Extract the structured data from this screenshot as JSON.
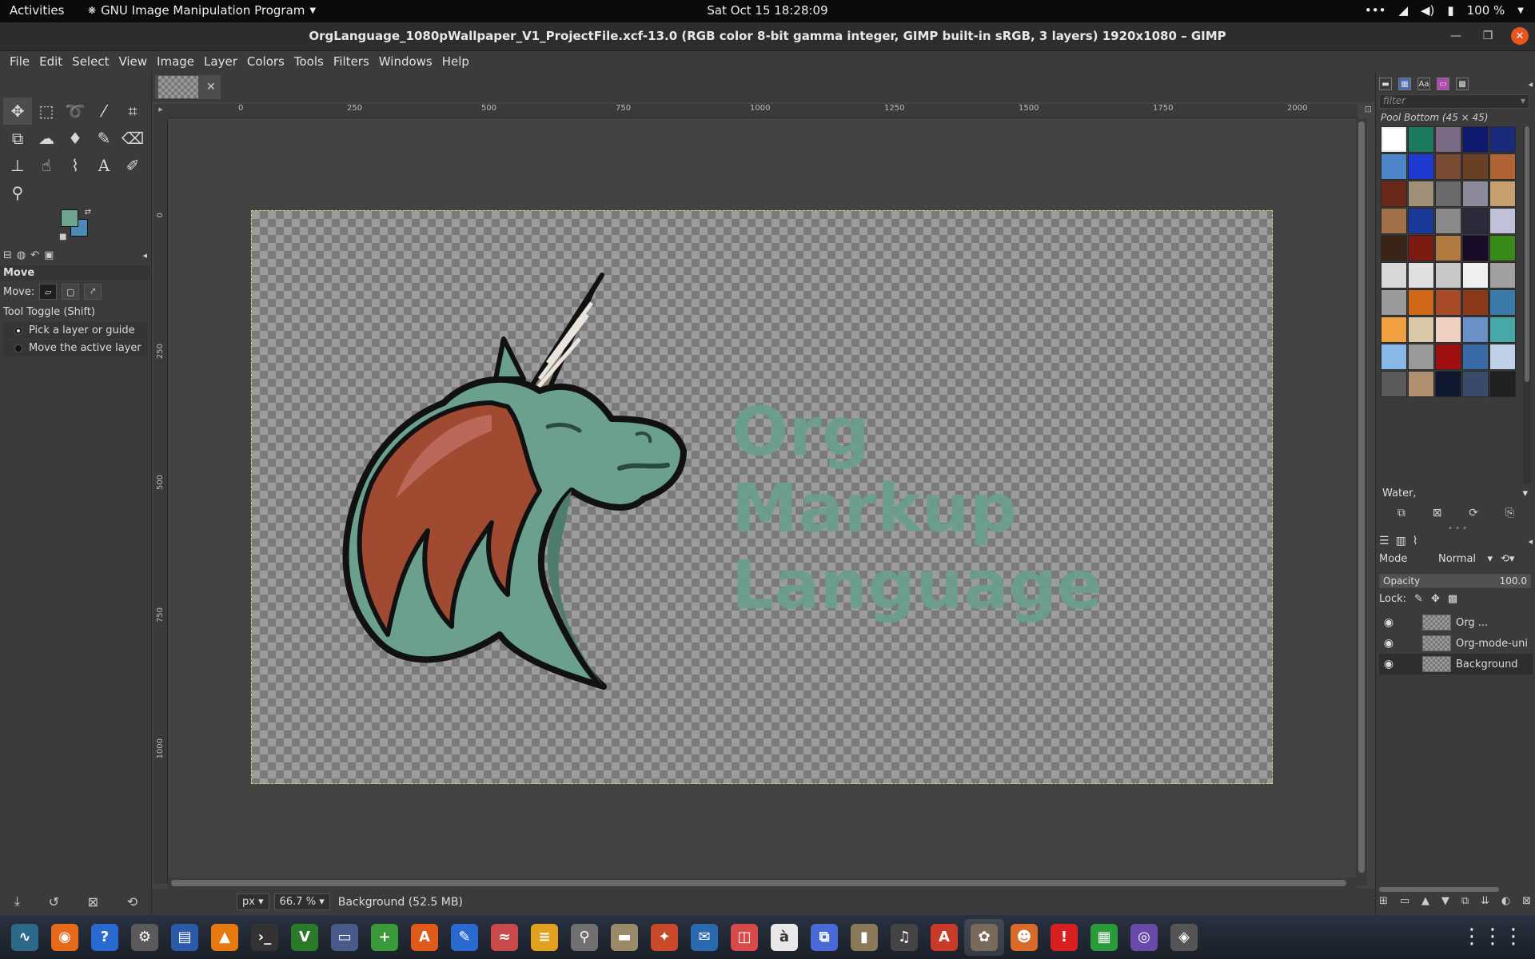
{
  "system": {
    "activities": "Activities",
    "app_menu": "GNU Image Manipulation Program",
    "clock": "Sat Oct 15  18:28:09",
    "battery": "100 %"
  },
  "window": {
    "title": "OrgLanguage_1080pWallpaper_V1_ProjectFile.xcf-13.0 (RGB color 8-bit gamma integer, GIMP built-in sRGB, 3 layers) 1920x1080 – GIMP"
  },
  "menu": [
    "File",
    "Edit",
    "Select",
    "View",
    "Image",
    "Layer",
    "Colors",
    "Tools",
    "Filters",
    "Windows",
    "Help"
  ],
  "toolbox": {
    "colors": {
      "foreground": "#6ea591",
      "background": "#4a8ab4"
    }
  },
  "tool_options": {
    "tool_name": "Move",
    "move_label": "Move:",
    "toggle_label": "Tool Toggle  (Shift)",
    "radio_1": "Pick a layer or guide",
    "radio_2": "Move the active layer"
  },
  "rulers": {
    "h_labels": [
      "0",
      "250",
      "500",
      "750",
      "1000",
      "1250",
      "1500",
      "1750",
      "2000"
    ],
    "v_labels": [
      "0",
      "250",
      "500",
      "750",
      "1000"
    ]
  },
  "canvas": {
    "line1": "Org",
    "line2": "Markup",
    "line3": "Language"
  },
  "status": {
    "unit": "px",
    "zoom": "66.7 %",
    "text": "Background (52.5 MB)"
  },
  "patterns_panel": {
    "filter_placeholder": "filter",
    "current_pattern": "Pool Bottom (45 × 45)",
    "selected_tag": "Water,",
    "swatches": [
      "#ffffff",
      "#1b7a5e",
      "#7a6a86",
      "#0d1a6e",
      "#1a2a7a",
      "#4a86c8",
      "#1e3ad0",
      "#7a4a32",
      "#6a4024",
      "#b06434",
      "#6a2a1a",
      "#a09078",
      "#6a6a6a",
      "#8a8a9a",
      "#c8a070",
      "#a07048",
      "#1a3a9a",
      "#8a8a8a",
      "#2a2a3a",
      "#c0c0d8",
      "#3a2418",
      "#7a1a10",
      "#b07a40",
      "#1a0a2a",
      "#3a8a1a",
      "#d8d8d8",
      "#e0e0e0",
      "#c8c8c8",
      "#f0f0f0",
      "#a0a0a0",
      "#9a9a9a",
      "#d06818",
      "#a84a28",
      "#8a3a1a",
      "#3a7aa8",
      "#f0a040",
      "#d8c8a8",
      "#f0d0c0",
      "#6a90c8",
      "#48a8a8",
      "#88b8e8",
      "#9a9a9a",
      "#a01010",
      "#3a6aa8",
      "#c0d0e8",
      "#5a5a5a",
      "#b09070",
      "#101830",
      "#3a4a6a",
      "#202020"
    ]
  },
  "layers_panel": {
    "mode_label": "Mode",
    "mode_value": "Normal",
    "opacity_label": "Opacity",
    "opacity_value": "100.0",
    "lock_label": "Lock:",
    "layers": [
      {
        "name": "Org ..."
      },
      {
        "name": "Org-mode-uni"
      },
      {
        "name": "Background"
      }
    ]
  },
  "taskbar": {
    "apps": [
      {
        "name": "system-monitor",
        "glyph": "∿",
        "color": "#2d6a8a"
      },
      {
        "name": "firefox",
        "glyph": "◉",
        "color": "#e66a1a"
      },
      {
        "name": "help",
        "glyph": "?",
        "color": "#2a6ad0"
      },
      {
        "name": "settings",
        "glyph": "⚙",
        "color": "#5a5a5a"
      },
      {
        "name": "document-viewer",
        "glyph": "▤",
        "color": "#2a5aa8"
      },
      {
        "name": "vlc",
        "glyph": "▲",
        "color": "#e67a10"
      },
      {
        "name": "terminal",
        "glyph": "›_",
        "color": "#333333"
      },
      {
        "name": "vim",
        "glyph": "V",
        "color": "#2a7a2a"
      },
      {
        "name": "screenshot",
        "glyph": "▭",
        "color": "#4a5a8a"
      },
      {
        "name": "plus-app",
        "glyph": "+",
        "color": "#3a9a3a"
      },
      {
        "name": "app-store",
        "glyph": "A",
        "color": "#e05a1a"
      },
      {
        "name": "text-editor",
        "glyph": "✎",
        "color": "#2a6ad0"
      },
      {
        "name": "charts",
        "glyph": "≈",
        "color": "#c84a4a"
      },
      {
        "name": "calculator",
        "glyph": "≡",
        "color": "#e0a020"
      },
      {
        "name": "search",
        "glyph": "⚲",
        "color": "#707070"
      },
      {
        "name": "files",
        "glyph": "▬",
        "color": "#9a8a6a"
      },
      {
        "name": "compass",
        "glyph": "✦",
        "color": "#c84a2a"
      },
      {
        "name": "mail",
        "glyph": "✉",
        "color": "#2a6ab0"
      },
      {
        "name": "reader",
        "glyph": "◫",
        "color": "#d84a4a"
      },
      {
        "name": "character-map",
        "glyph": "à",
        "color": "#e8e8e8"
      },
      {
        "name": "remote",
        "glyph": "⧉",
        "color": "#4a6ad8"
      },
      {
        "name": "archive",
        "glyph": "▮",
        "color": "#8a7a5a"
      },
      {
        "name": "music",
        "glyph": "♫",
        "color": "#444444"
      },
      {
        "name": "presentation",
        "glyph": "A",
        "color": "#c83a2a"
      },
      {
        "name": "gimp",
        "glyph": "✿",
        "color": "#7a6a5a"
      },
      {
        "name": "game",
        "glyph": "☻",
        "color": "#d86a2a"
      },
      {
        "name": "alert",
        "glyph": "!",
        "color": "#d82020"
      },
      {
        "name": "spreadsheet",
        "glyph": "▦",
        "color": "#2a9a3a"
      },
      {
        "name": "camera",
        "glyph": "◎",
        "color": "#6a4aa8"
      },
      {
        "name": "inkscape",
        "glyph": "◈",
        "color": "#555555"
      }
    ]
  }
}
